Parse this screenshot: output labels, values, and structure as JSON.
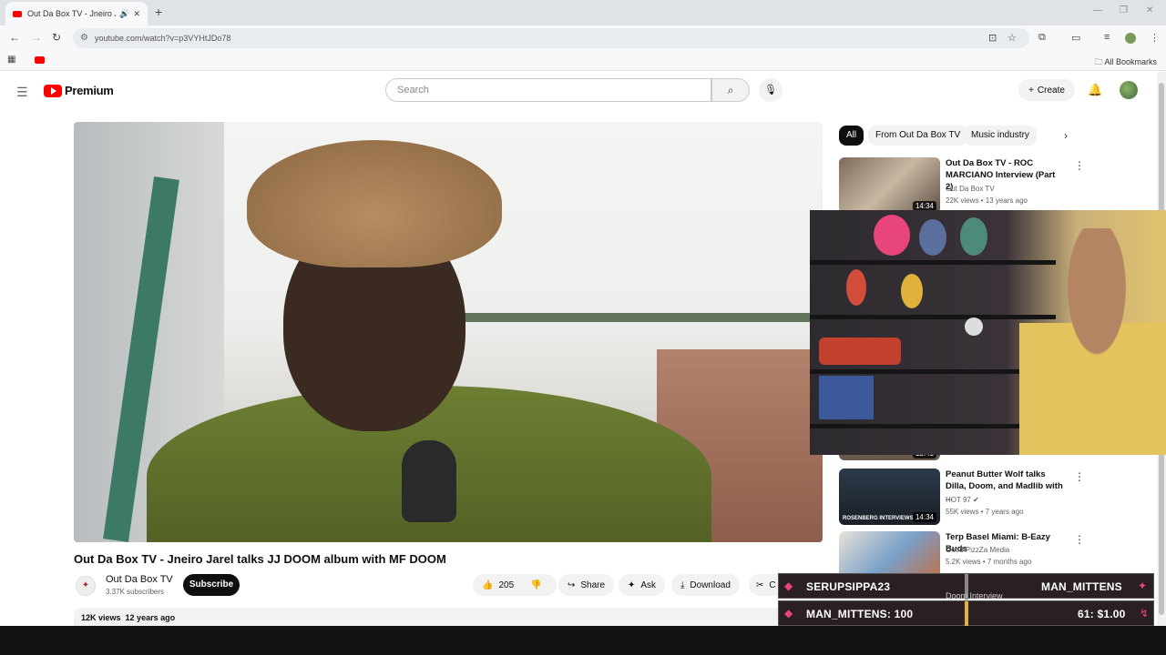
{
  "browser": {
    "tab_title": "Out Da Box TV - Jneiro Jarel",
    "url": "youtube.com/watch?v=p3VYHtJDo78",
    "all_bookmarks": "All Bookmarks"
  },
  "header": {
    "logo_text": "Premium",
    "search_placeholder": "Search",
    "create_label": "Create"
  },
  "video": {
    "title": "Out Da Box TV - Jneiro Jarel talks JJ DOOM album with MF DOOM",
    "channel": "Out Da Box TV",
    "subscribers": "3.37K subscribers",
    "subscribe_label": "Subscribe",
    "likes": "205",
    "share_label": "Share",
    "ask_label": "Ask",
    "download_label": "Download",
    "clip_label": "C",
    "views": "12K views",
    "age": "12 years ago"
  },
  "chips": [
    "All",
    "From Out Da Box TV",
    "Music industry"
  ],
  "recommendations": [
    {
      "title": "Out Da Box TV - ROC MARCIANO Interview (Part 2)",
      "channel": "Out Da Box TV",
      "meta": "22K views • 13 years ago",
      "duration": "14:34"
    },
    {
      "title": "Peanut Butter Wolf talks Dilla, Doom, and Madlib with ...",
      "channel": "HOT 97",
      "meta": "55K views • 7 years ago",
      "duration": "14:34",
      "thumb_text": "ROSENBERG INTERVIEWS"
    },
    {
      "title": "Terp Basel Miami: B-Eazy Buds",
      "channel": "Good PizzZa Media",
      "meta": "5.2K views • 7 months ago",
      "duration": ""
    }
  ],
  "hidden_duration": "12:41",
  "stream": {
    "user1": "SERUPSIPPA23",
    "user2": "MAN_MITTENS",
    "line2_left": "MAN_MITTENS: 100",
    "line2_right": "61: $1.00",
    "peek_text": "Doom Interview"
  },
  "colors": {
    "youtube_red": "#ff0000",
    "banner_bg": "#2a1f24",
    "webcam_accent": "#e2c26d"
  }
}
